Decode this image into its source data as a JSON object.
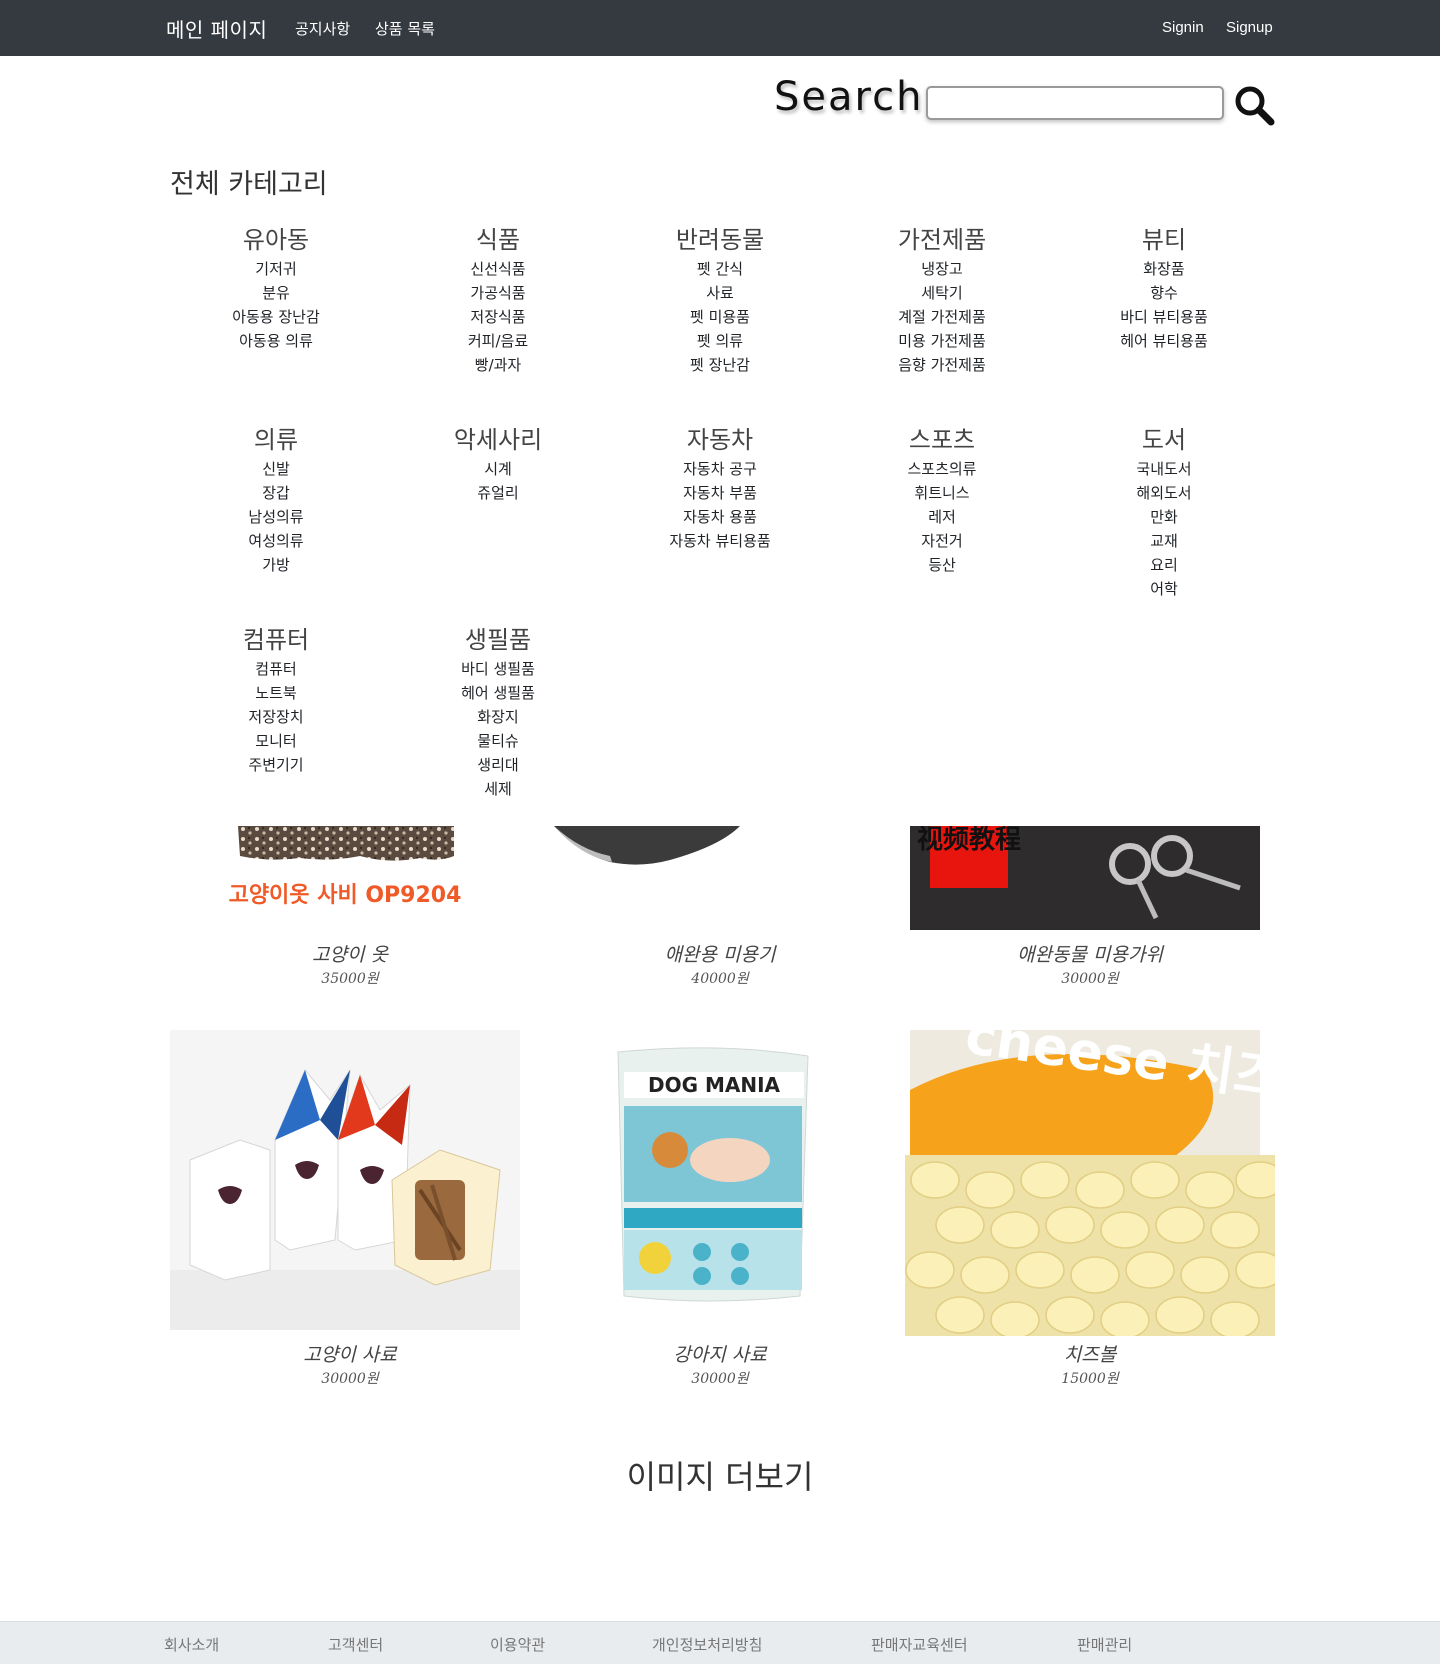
{
  "navbar": {
    "brand": "메인 페이지",
    "links": [
      "공지사항",
      "상품 목록"
    ],
    "signin": "Signin",
    "signup": "Signup"
  },
  "search": {
    "label": "Search",
    "value": "",
    "placeholder": "",
    "icon": "search-icon"
  },
  "categories": {
    "title": "전체 카테고리",
    "groups": [
      {
        "name": "유아동",
        "items": [
          "기저귀",
          "분유",
          "아동용 장난감",
          "아동용 의류"
        ]
      },
      {
        "name": "식품",
        "items": [
          "신선식품",
          "가공식품",
          "저장식품",
          "커피/음료",
          "빵/과자"
        ]
      },
      {
        "name": "반려동물",
        "items": [
          "펫 간식",
          "사료",
          "펫 미용품",
          "펫 의류",
          "펫 장난감"
        ]
      },
      {
        "name": "가전제품",
        "items": [
          "냉장고",
          "세탁기",
          "계절 가전제품",
          "미용 가전제품",
          "음향 가전제품"
        ]
      },
      {
        "name": "뷰티",
        "items": [
          "화장품",
          "향수",
          "바디 뷰티용품",
          "헤어 뷰티용품"
        ]
      },
      {
        "name": "의류",
        "items": [
          "신발",
          "장갑",
          "남성의류",
          "여성의류",
          "가방"
        ]
      },
      {
        "name": "악세사리",
        "items": [
          "시계",
          "쥬얼리"
        ]
      },
      {
        "name": "자동차",
        "items": [
          "자동차 공구",
          "자동차 부품",
          "자동차 용품",
          "자동차 뷰티용품"
        ]
      },
      {
        "name": "스포츠",
        "items": [
          "스포츠의류",
          "휘트니스",
          "레저",
          "자전거",
          "등산"
        ]
      },
      {
        "name": "도서",
        "items": [
          "국내도서",
          "해외도서",
          "만화",
          "교재",
          "요리",
          "어학"
        ]
      },
      {
        "name": "컴퓨터",
        "items": [
          "컴퓨터",
          "노트북",
          "저장장치",
          "모니터",
          "주변기기"
        ]
      },
      {
        "name": "생필품",
        "items": [
          "바디 생필품",
          "헤어 생필품",
          "화장지",
          "물티슈",
          "생리대",
          "세제"
        ]
      }
    ]
  },
  "products": [
    {
      "name": "고양이 옷",
      "price": "35000원",
      "image_text": "고양이옷 사비 OP9204"
    },
    {
      "name": "애완용 미용기",
      "price": "40000원"
    },
    {
      "name": "애완동물 미용가위",
      "price": "30000원",
      "image_text": "视频教程"
    },
    {
      "name": "고양이 사료",
      "price": "30000원"
    },
    {
      "name": "강아지 사료",
      "price": "30000원",
      "image_text": "DOG MANIA"
    },
    {
      "name": "치즈볼",
      "price": "15000원",
      "image_text": "cheese 치즈볼"
    }
  ],
  "more_images": "이미지 더보기",
  "footer": {
    "links": [
      "회사소개",
      "고객센터",
      "이용약관",
      "개인정보처리방침",
      "판매자교육센터",
      "판매관리"
    ]
  },
  "colors": {
    "navbar_bg": "#343a40",
    "footer_bg": "#e9ecef",
    "accent_orange": "#f05a28"
  }
}
